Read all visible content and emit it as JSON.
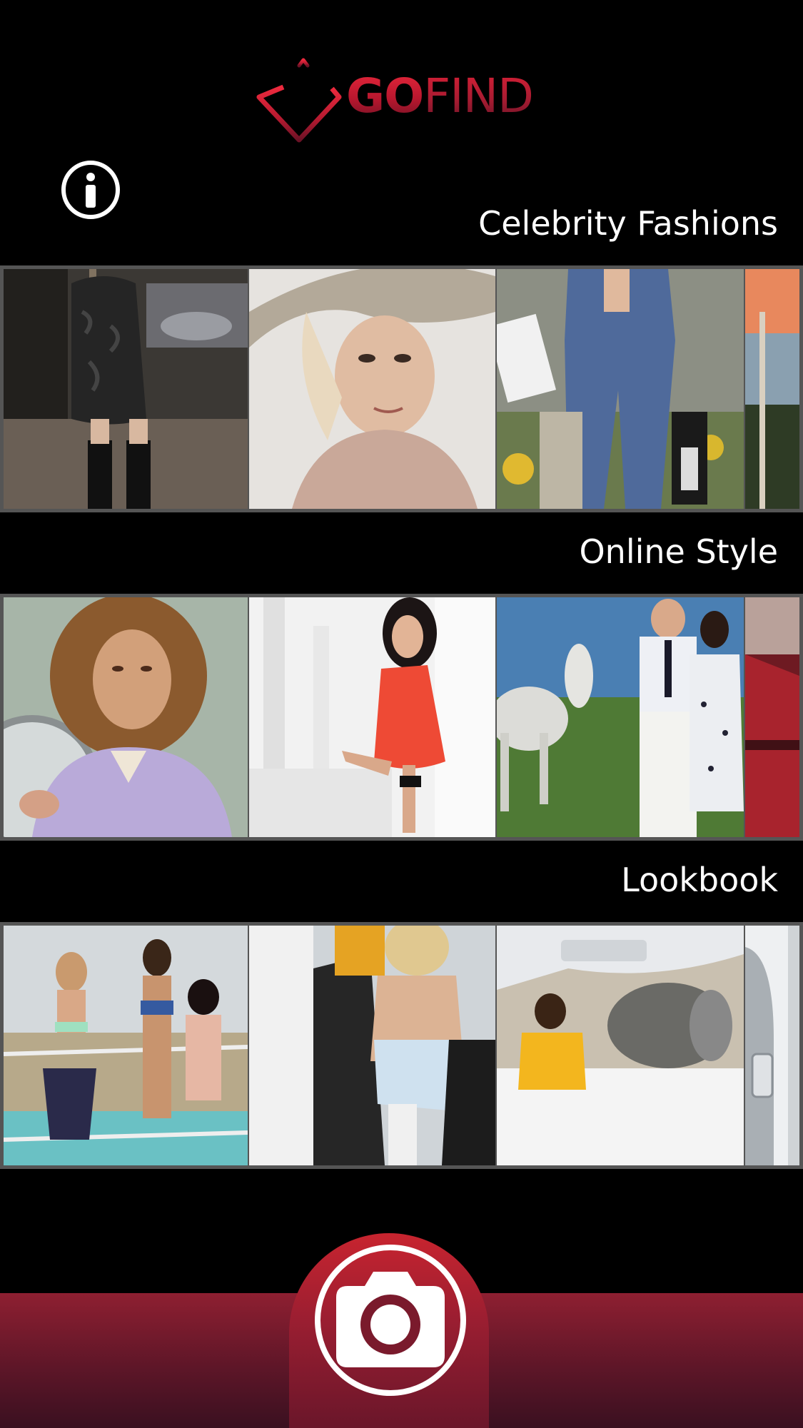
{
  "app": {
    "logo_primary": "GO",
    "logo_secondary": "FIND",
    "brand_color": "#c8202f"
  },
  "header": {
    "info_icon": "info-circle-icon"
  },
  "sections": [
    {
      "title": "Celebrity Fashions",
      "images": [
        "woman-black-dress-boots",
        "woman-wide-brim-hat",
        "woman-denim-jumpsuit-shopping",
        "sunset-partial"
      ]
    },
    {
      "title": "Online Style",
      "images": [
        "curly-hair-woman-lilac-top",
        "woman-red-dress-white-wall",
        "couple-with-white-horses",
        "red-car-partial"
      ]
    },
    {
      "title": "Lookbook",
      "images": [
        "women-swimwear-on-boat",
        "women-beside-car",
        "person-yellow-hoodie-jet",
        "white-car-door-partial"
      ]
    }
  ],
  "footer": {
    "camera_icon": "camera-icon"
  }
}
